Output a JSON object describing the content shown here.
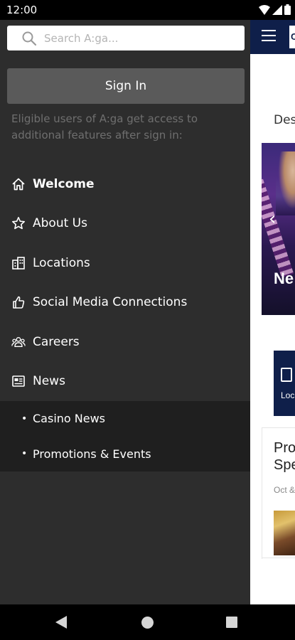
{
  "status_bar": {
    "time": "12:00",
    "icons": [
      "wifi-icon",
      "signal-icon",
      "battery-icon"
    ]
  },
  "drawer": {
    "search": {
      "placeholder": "Search A:ga..."
    },
    "sign_in_label": "Sign In",
    "sign_in_note": "Eligible users of A:ga get access to additional features after sign in:",
    "items": [
      {
        "label": "Welcome",
        "icon": "home-icon",
        "active": true
      },
      {
        "label": "About Us",
        "icon": "star-icon"
      },
      {
        "label": "Locations",
        "icon": "building-icon"
      },
      {
        "label": "Social Media Connections",
        "icon": "thumbs-up-icon"
      },
      {
        "label": "Careers",
        "icon": "people-icon"
      },
      {
        "label": "News",
        "icon": "newspaper-icon"
      }
    ],
    "sub_items": [
      {
        "label": "Casino News"
      },
      {
        "label": "Promotions & Events"
      }
    ]
  },
  "background_app": {
    "des_text": "Des",
    "hero_text": "Ne",
    "card_text": "Loc",
    "card2_title_line1": "Pro",
    "card2_title_line2": "Spe",
    "card2_date": "Oct &"
  },
  "colors": {
    "drawer_bg": "#2d2d2d",
    "subnav_bg": "#1f1f1f",
    "header_navy": "#0f1f4a",
    "signin_btn": "#5a5a5a"
  }
}
